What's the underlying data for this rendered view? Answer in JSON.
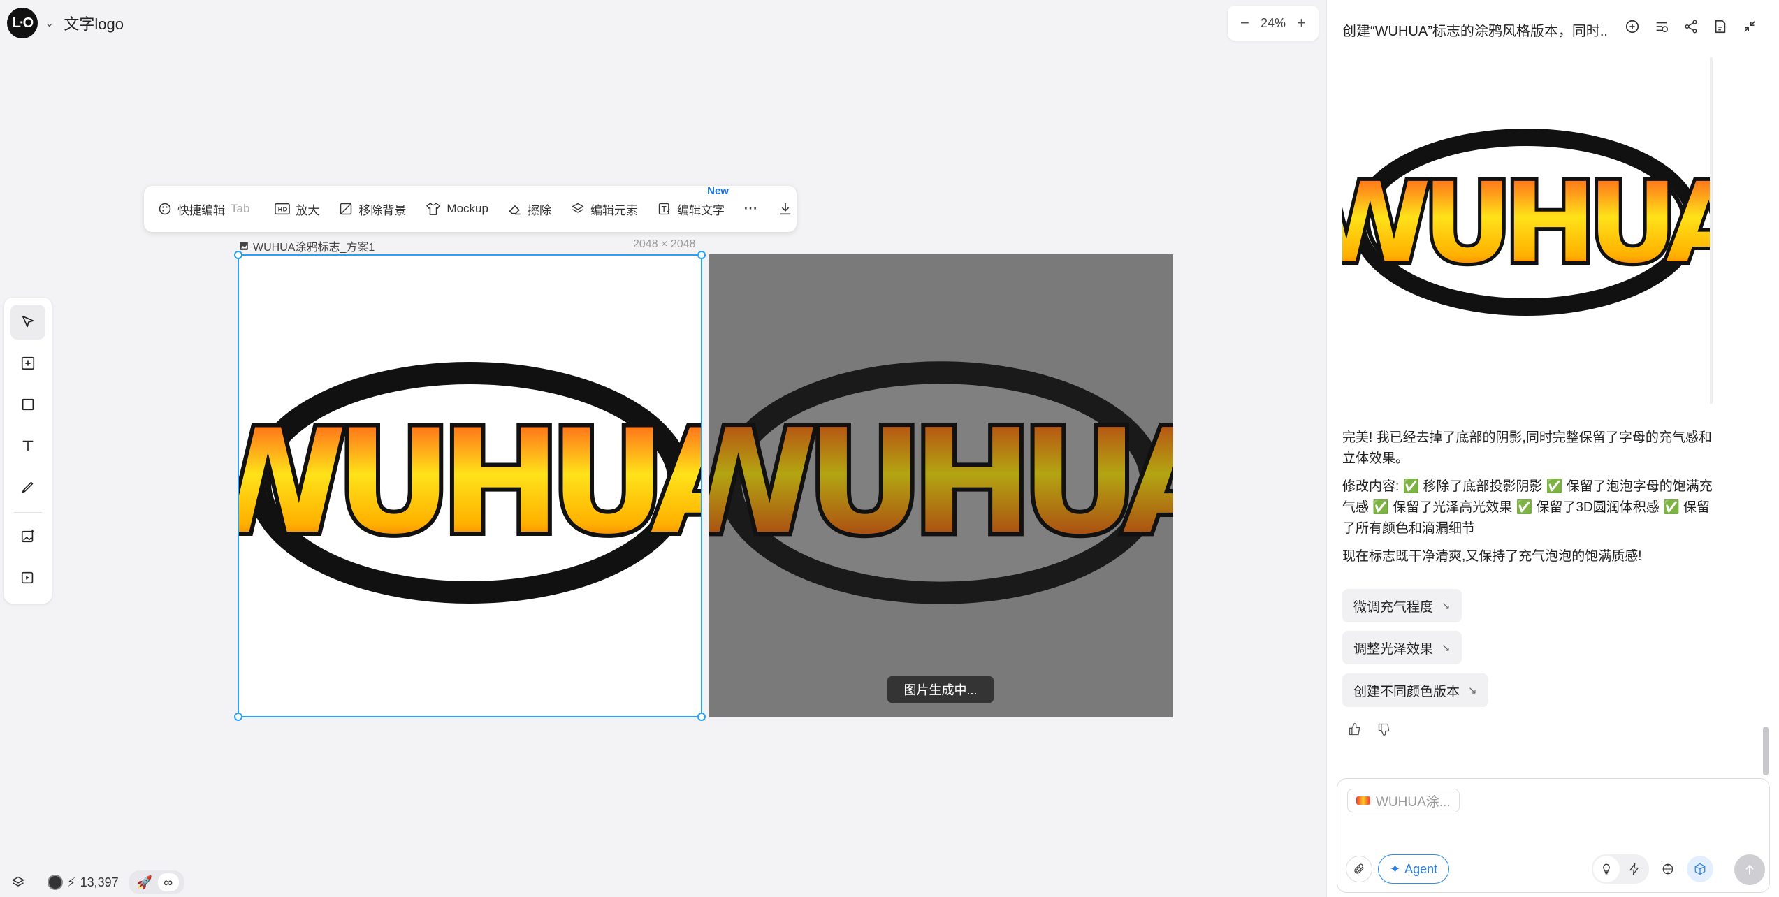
{
  "app": {
    "logo_text": "L·O",
    "project_name": "文字logo"
  },
  "zoom": {
    "minus": "−",
    "value": "24%",
    "plus": "+"
  },
  "toolbar": {
    "quick_edit": "快捷编辑",
    "quick_edit_hint": "Tab",
    "upscale": "放大",
    "remove_bg": "移除背景",
    "mockup": "Mockup",
    "erase": "擦除",
    "edit_elements": "编辑元素",
    "edit_text": "编辑文字",
    "new_badge": "New",
    "more": "···"
  },
  "canvas": {
    "image_name": "WUHUA涂鸦标志_方案1",
    "image_size": "2048 × 2048",
    "logo_text": "WUHUA",
    "generating": "图片生成中..."
  },
  "status": {
    "credits": "13,397",
    "infinity": "∞"
  },
  "panel": {
    "title": "创建“WUHUA”标志的涂鸦风格版本，同时...",
    "msg1": "完美! 我已经去掉了底部的阴影,同时完整保留了字母的充气感和立体效果。",
    "msg2": "修改内容: ✅ 移除了底部投影阴影 ✅ 保留了泡泡字母的饱满充气感 ✅ 保留了光泽高光效果 ✅ 保留了3D圆润体积感 ✅ 保留了所有颜色和滴漏细节",
    "msg3": "现在标志既干净清爽,又保持了充气泡泡的饱满质感!",
    "suggestions": [
      "微调充气程度",
      "调整光泽效果",
      "创建不同颜色版本"
    ],
    "input_ref": "WUHUA涂...",
    "agent_label": "Agent"
  },
  "colors": {
    "accent": "#2aa1f5",
    "agent_blue": "#2a7ee0",
    "logo_red": "#e8321c",
    "logo_yellow": "#ffe21a"
  }
}
